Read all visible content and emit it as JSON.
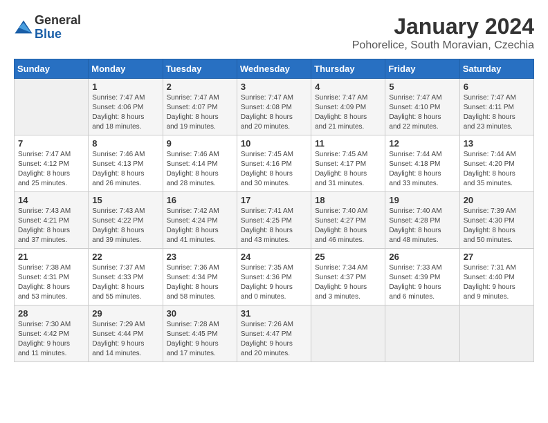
{
  "header": {
    "logo_general": "General",
    "logo_blue": "Blue",
    "title": "January 2024",
    "subtitle": "Pohorelice, South Moravian, Czechia"
  },
  "weekdays": [
    "Sunday",
    "Monday",
    "Tuesday",
    "Wednesday",
    "Thursday",
    "Friday",
    "Saturday"
  ],
  "weeks": [
    [
      {
        "day": "",
        "info": ""
      },
      {
        "day": "1",
        "info": "Sunrise: 7:47 AM\nSunset: 4:06 PM\nDaylight: 8 hours\nand 18 minutes."
      },
      {
        "day": "2",
        "info": "Sunrise: 7:47 AM\nSunset: 4:07 PM\nDaylight: 8 hours\nand 19 minutes."
      },
      {
        "day": "3",
        "info": "Sunrise: 7:47 AM\nSunset: 4:08 PM\nDaylight: 8 hours\nand 20 minutes."
      },
      {
        "day": "4",
        "info": "Sunrise: 7:47 AM\nSunset: 4:09 PM\nDaylight: 8 hours\nand 21 minutes."
      },
      {
        "day": "5",
        "info": "Sunrise: 7:47 AM\nSunset: 4:10 PM\nDaylight: 8 hours\nand 22 minutes."
      },
      {
        "day": "6",
        "info": "Sunrise: 7:47 AM\nSunset: 4:11 PM\nDaylight: 8 hours\nand 23 minutes."
      }
    ],
    [
      {
        "day": "7",
        "info": "Sunrise: 7:47 AM\nSunset: 4:12 PM\nDaylight: 8 hours\nand 25 minutes."
      },
      {
        "day": "8",
        "info": "Sunrise: 7:46 AM\nSunset: 4:13 PM\nDaylight: 8 hours\nand 26 minutes."
      },
      {
        "day": "9",
        "info": "Sunrise: 7:46 AM\nSunset: 4:14 PM\nDaylight: 8 hours\nand 28 minutes."
      },
      {
        "day": "10",
        "info": "Sunrise: 7:45 AM\nSunset: 4:16 PM\nDaylight: 8 hours\nand 30 minutes."
      },
      {
        "day": "11",
        "info": "Sunrise: 7:45 AM\nSunset: 4:17 PM\nDaylight: 8 hours\nand 31 minutes."
      },
      {
        "day": "12",
        "info": "Sunrise: 7:44 AM\nSunset: 4:18 PM\nDaylight: 8 hours\nand 33 minutes."
      },
      {
        "day": "13",
        "info": "Sunrise: 7:44 AM\nSunset: 4:20 PM\nDaylight: 8 hours\nand 35 minutes."
      }
    ],
    [
      {
        "day": "14",
        "info": "Sunrise: 7:43 AM\nSunset: 4:21 PM\nDaylight: 8 hours\nand 37 minutes."
      },
      {
        "day": "15",
        "info": "Sunrise: 7:43 AM\nSunset: 4:22 PM\nDaylight: 8 hours\nand 39 minutes."
      },
      {
        "day": "16",
        "info": "Sunrise: 7:42 AM\nSunset: 4:24 PM\nDaylight: 8 hours\nand 41 minutes."
      },
      {
        "day": "17",
        "info": "Sunrise: 7:41 AM\nSunset: 4:25 PM\nDaylight: 8 hours\nand 43 minutes."
      },
      {
        "day": "18",
        "info": "Sunrise: 7:40 AM\nSunset: 4:27 PM\nDaylight: 8 hours\nand 46 minutes."
      },
      {
        "day": "19",
        "info": "Sunrise: 7:40 AM\nSunset: 4:28 PM\nDaylight: 8 hours\nand 48 minutes."
      },
      {
        "day": "20",
        "info": "Sunrise: 7:39 AM\nSunset: 4:30 PM\nDaylight: 8 hours\nand 50 minutes."
      }
    ],
    [
      {
        "day": "21",
        "info": "Sunrise: 7:38 AM\nSunset: 4:31 PM\nDaylight: 8 hours\nand 53 minutes."
      },
      {
        "day": "22",
        "info": "Sunrise: 7:37 AM\nSunset: 4:33 PM\nDaylight: 8 hours\nand 55 minutes."
      },
      {
        "day": "23",
        "info": "Sunrise: 7:36 AM\nSunset: 4:34 PM\nDaylight: 8 hours\nand 58 minutes."
      },
      {
        "day": "24",
        "info": "Sunrise: 7:35 AM\nSunset: 4:36 PM\nDaylight: 9 hours\nand 0 minutes."
      },
      {
        "day": "25",
        "info": "Sunrise: 7:34 AM\nSunset: 4:37 PM\nDaylight: 9 hours\nand 3 minutes."
      },
      {
        "day": "26",
        "info": "Sunrise: 7:33 AM\nSunset: 4:39 PM\nDaylight: 9 hours\nand 6 minutes."
      },
      {
        "day": "27",
        "info": "Sunrise: 7:31 AM\nSunset: 4:40 PM\nDaylight: 9 hours\nand 9 minutes."
      }
    ],
    [
      {
        "day": "28",
        "info": "Sunrise: 7:30 AM\nSunset: 4:42 PM\nDaylight: 9 hours\nand 11 minutes."
      },
      {
        "day": "29",
        "info": "Sunrise: 7:29 AM\nSunset: 4:44 PM\nDaylight: 9 hours\nand 14 minutes."
      },
      {
        "day": "30",
        "info": "Sunrise: 7:28 AM\nSunset: 4:45 PM\nDaylight: 9 hours\nand 17 minutes."
      },
      {
        "day": "31",
        "info": "Sunrise: 7:26 AM\nSunset: 4:47 PM\nDaylight: 9 hours\nand 20 minutes."
      },
      {
        "day": "",
        "info": ""
      },
      {
        "day": "",
        "info": ""
      },
      {
        "day": "",
        "info": ""
      }
    ]
  ]
}
